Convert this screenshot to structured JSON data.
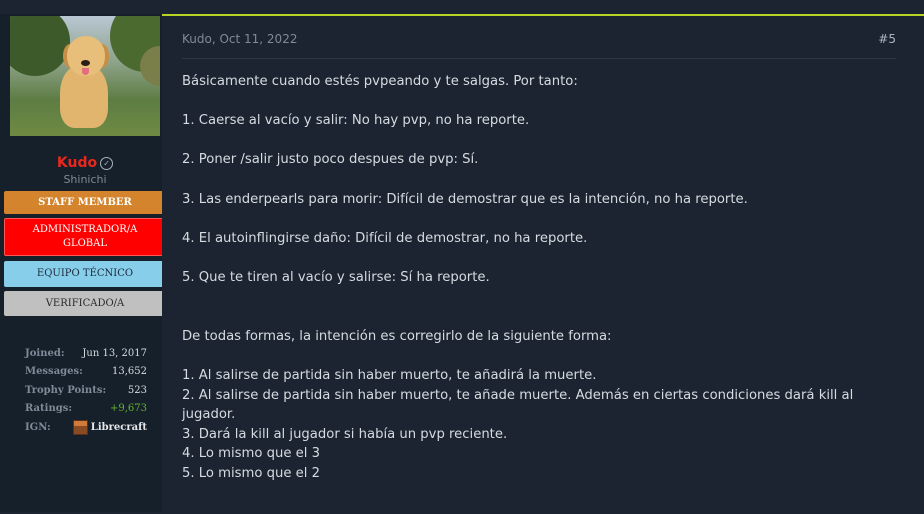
{
  "user": {
    "name": "Kudo",
    "title": "Shinichi",
    "badges": [
      "STAFF MEMBER",
      "ADMINISTRADOR/A GLOBAL",
      "EQUIPO TÉCNICO",
      "VERIFICADO/A"
    ],
    "stats": [
      {
        "label": "Joined:",
        "value": "Jun 13, 2017"
      },
      {
        "label": "Messages:",
        "value": "13,652"
      },
      {
        "label": "Trophy Points:",
        "value": "523"
      },
      {
        "label": "Ratings:",
        "value": "+9,673"
      },
      {
        "label": "IGN:",
        "value": "Librecraft"
      }
    ]
  },
  "post": {
    "date": "Kudo, Oct 11, 2022",
    "number": "#5",
    "lines": [
      "Básicamente cuando estés pvpeando y te salgas. Por tanto:",
      "1. Caerse al vacío y salir: No hay pvp, no ha reporte.",
      "2. Poner /salir justo poco despues de pvp: Sí.",
      "3. Las enderpearls para morir: Difícil de demostrar que es la intención, no ha reporte.",
      "4. El autoinflingirse daño: Difícil de demostrar, no ha reporte.",
      "5. Que te tiren al vacío y salirse: Sí ha reporte.",
      "De todas formas, la intención es corregirlo de la siguiente forma:",
      "1. Al salirse de partida sin haber muerto, te añadirá la muerte.",
      "2. Al salirse de partida sin haber muerto, te añade muerte. Además en ciertas condiciones dará kill al jugador.",
      "3. Dará la kill al jugador si había un pvp reciente.",
      "4. Lo mismo que el 3",
      "5. Lo mismo que el 2"
    ]
  },
  "colors": {
    "username": "#e8281e",
    "accent_border": "#b8d323",
    "staff": "#d3842c",
    "admin": "#ff0000",
    "tech": "#87ceeb",
    "verified": "#c0c0c0",
    "ratings_positive": "#63b32e"
  },
  "icons": {
    "verified": "check-circle-icon",
    "ign": "minecraft-block-icon"
  }
}
